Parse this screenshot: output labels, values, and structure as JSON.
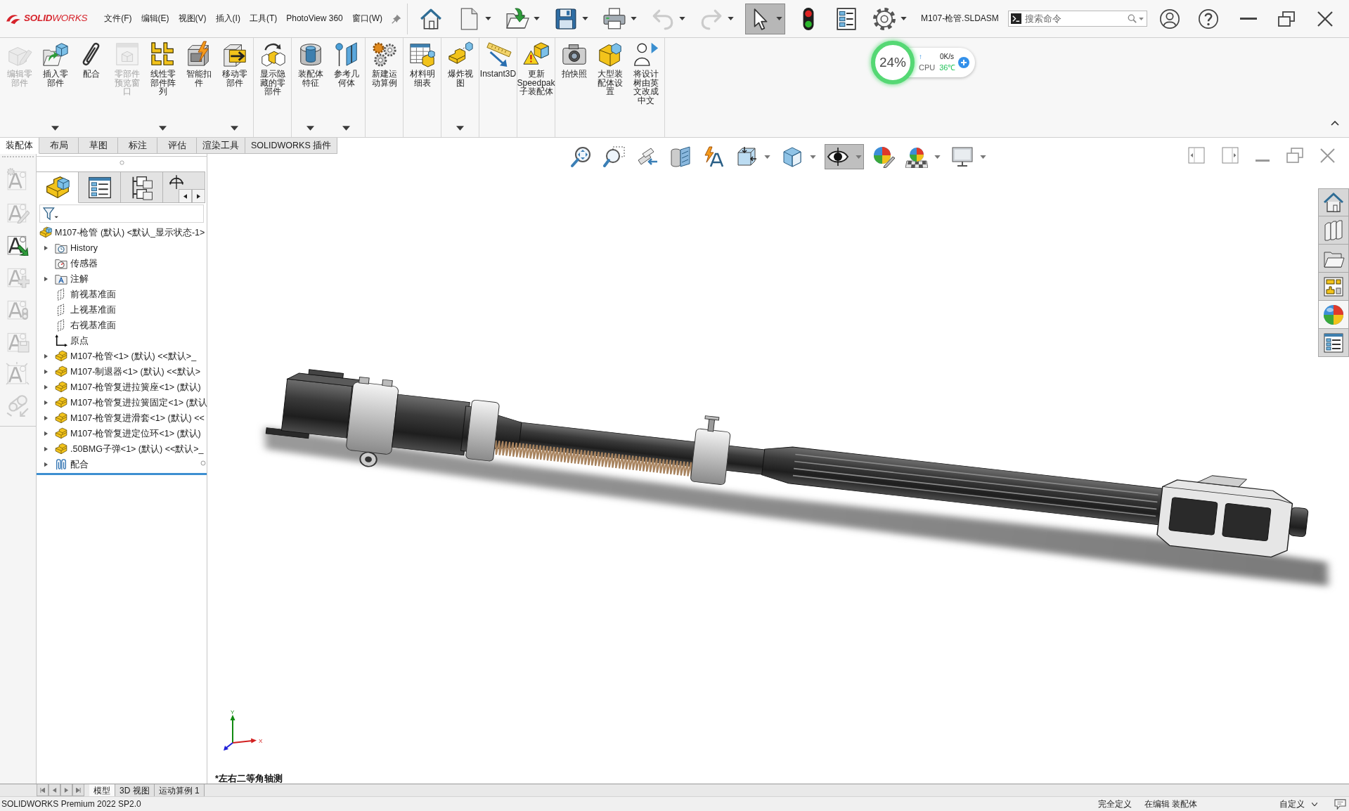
{
  "title_bar": {
    "logo": "**SOLID**WORKS",
    "menus": [
      "文件(F)",
      "编辑(E)",
      "视图(V)",
      "插入(I)",
      "工具(T)",
      "PhotoView 360",
      "窗口(W)"
    ],
    "tools": [
      {
        "kind": "home",
        "dropdown": false,
        "disabled": false,
        "pressed": false
      },
      {
        "kind": "new",
        "dropdown": true,
        "disabled": false,
        "pressed": false
      },
      {
        "kind": "open",
        "dropdown": true,
        "disabled": false,
        "pressed": false
      },
      {
        "kind": "save",
        "dropdown": true,
        "disabled": false,
        "pressed": false
      },
      {
        "kind": "print",
        "dropdown": true,
        "disabled": false,
        "pressed": false
      },
      {
        "kind": "undo",
        "dropdown": true,
        "disabled": true,
        "pressed": false
      },
      {
        "kind": "redo",
        "dropdown": true,
        "disabled": true,
        "pressed": false
      },
      {
        "kind": "select",
        "dropdown": true,
        "disabled": false,
        "pressed": true
      },
      {
        "kind": "rebuild",
        "dropdown": false,
        "disabled": false,
        "pressed": false
      },
      {
        "kind": "file-properties",
        "dropdown": false,
        "disabled": false,
        "pressed": false
      },
      {
        "kind": "options",
        "dropdown": true,
        "disabled": false,
        "pressed": false
      }
    ],
    "document_title": "M107-枪管.SLDASM",
    "search": {
      "placeholder": "搜索命令"
    }
  },
  "system_monitor": {
    "load": "24%",
    "arrow": "↑",
    "speed": "0K/s",
    "label": "CPU",
    "temperature": "36℃"
  },
  "command_manager": {
    "groups": [
      {
        "commands": [
          {
            "label": "编辑零部件",
            "kind": "edit-part",
            "dropdown": false,
            "disabled": true
          },
          {
            "label": "插入零部件",
            "kind": "insert-part",
            "dropdown": true,
            "disabled": false
          },
          {
            "label": "配合",
            "kind": "mate",
            "dropdown": false,
            "disabled": false
          },
          {
            "label": "零部件预览窗口",
            "kind": "preview-window",
            "dropdown": false,
            "disabled": true
          },
          {
            "label": "线性零部件阵列",
            "kind": "linear-pattern",
            "dropdown": true,
            "disabled": false
          },
          {
            "label": "智能扣件",
            "kind": "smart-fastener",
            "dropdown": false,
            "disabled": false
          },
          {
            "label": "移动零部件",
            "kind": "move-part",
            "dropdown": true,
            "disabled": false
          }
        ]
      },
      {
        "commands": [
          {
            "label": "显示隐藏的零部件",
            "kind": "show-hidden",
            "dropdown": false,
            "disabled": false
          }
        ]
      },
      {
        "commands": [
          {
            "label": "装配体特征",
            "kind": "assembly-feature",
            "dropdown": true,
            "disabled": false
          },
          {
            "label": "参考几何体",
            "kind": "reference-geometry",
            "dropdown": true,
            "disabled": false
          }
        ]
      },
      {
        "commands": [
          {
            "label": "新建运动算例",
            "kind": "motion-study",
            "dropdown": false,
            "disabled": false
          }
        ]
      },
      {
        "commands": [
          {
            "label": "材料明细表",
            "kind": "bom",
            "dropdown": false,
            "disabled": false
          }
        ]
      },
      {
        "commands": [
          {
            "label": "爆炸视图",
            "kind": "exploded-view",
            "dropdown": true,
            "disabled": false
          }
        ]
      },
      {
        "commands": [
          {
            "label": "Instant3D",
            "kind": "instant3d",
            "dropdown": false,
            "disabled": false
          }
        ]
      },
      {
        "commands": [
          {
            "label": "更新Speedpak子装配体",
            "kind": "speedpak",
            "dropdown": false,
            "disabled": false
          }
        ]
      },
      {
        "commands": [
          {
            "label": "拍快照",
            "kind": "snapshot",
            "dropdown": false,
            "disabled": false
          },
          {
            "label": "大型装配体设置",
            "kind": "large-assembly",
            "dropdown": false,
            "disabled": false
          },
          {
            "label": "将设计树由英文改成中文",
            "kind": "translate-tree",
            "dropdown": false,
            "disabled": false
          }
        ]
      }
    ]
  },
  "tabs": [
    {
      "label": "装配体",
      "selected": true
    },
    {
      "label": "布局",
      "selected": false
    },
    {
      "label": "草图",
      "selected": false
    },
    {
      "label": "标注",
      "selected": false
    },
    {
      "label": "评估",
      "selected": false
    },
    {
      "label": "渲染工具",
      "selected": false
    },
    {
      "label": "SOLIDWORKS 插件",
      "selected": false
    }
  ],
  "left_toolbar": [
    {
      "kind": "annotation-settings",
      "disabled": true
    },
    {
      "kind": "annotation-edit",
      "disabled": true
    },
    {
      "kind": "annotation-import",
      "disabled": false
    },
    {
      "kind": "annotation-add",
      "disabled": true
    },
    {
      "kind": "annotation-status",
      "disabled": true
    },
    {
      "kind": "annotation-save",
      "disabled": true
    },
    {
      "kind": "annotation-burst",
      "disabled": true
    },
    {
      "kind": "linkage",
      "disabled": true
    }
  ],
  "feature_manager": {
    "tabs": [
      {
        "kind": "feature-tree",
        "selected": true
      },
      {
        "kind": "property-manager",
        "selected": false
      },
      {
        "kind": "configuration-manager",
        "selected": false
      },
      {
        "kind": "dimxpert-manager",
        "selected": false
      }
    ],
    "tree": [
      {
        "label": "M107-枪管 (默认) <默认_显示状态-1>",
        "kind": "assembly",
        "expander": false,
        "children": [
          {
            "label": "History",
            "kind": "history",
            "expander": true
          },
          {
            "label": "传感器",
            "kind": "sensors",
            "expander": false
          },
          {
            "label": "注解",
            "kind": "annotations",
            "expander": true
          },
          {
            "label": "前视基准面",
            "kind": "plane",
            "expander": false
          },
          {
            "label": "上视基准面",
            "kind": "plane",
            "expander": false
          },
          {
            "label": "右视基准面",
            "kind": "plane",
            "expander": false
          },
          {
            "label": "原点",
            "kind": "origin",
            "expander": false
          },
          {
            "label": "M107-枪管<1> (默认) <<默认>_",
            "kind": "part",
            "expander": true
          },
          {
            "label": "M107-制退器<1> (默认) <<默认>",
            "kind": "part",
            "expander": true
          },
          {
            "label": "M107-枪管复进拉簧座<1> (默认)",
            "kind": "part",
            "expander": true
          },
          {
            "label": "M107-枪管复进拉簧固定<1> (默认",
            "kind": "part",
            "expander": true
          },
          {
            "label": "M107-枪管复进滑套<1> (默认) <<",
            "kind": "part",
            "expander": true
          },
          {
            "label": "M107-枪管复进定位环<1> (默认)",
            "kind": "part",
            "expander": true
          },
          {
            "label": ".50BMG子弹<1> (默认) <<默认>_",
            "kind": "part",
            "expander": true
          },
          {
            "label": "配合",
            "kind": "mates",
            "expander": true
          }
        ]
      }
    ]
  },
  "view_toolbar": [
    {
      "kind": "zoom-to-fit",
      "dropdown": false,
      "pressed": false
    },
    {
      "kind": "zoom-area",
      "dropdown": false,
      "pressed": false
    },
    {
      "kind": "previous-view",
      "dropdown": false,
      "pressed": false
    },
    {
      "kind": "section-view",
      "dropdown": false,
      "pressed": false
    },
    {
      "kind": "dynamic-annotation",
      "dropdown": false,
      "pressed": false
    },
    {
      "kind": "view-orientation",
      "dropdown": true,
      "pressed": false
    },
    {
      "kind": "display-style",
      "dropdown": true,
      "pressed": false
    },
    {
      "kind": "hide-show",
      "dropdown": true,
      "pressed": true
    },
    {
      "kind": "edit-appearance",
      "dropdown": false,
      "pressed": false
    },
    {
      "kind": "apply-scene",
      "dropdown": true,
      "pressed": false
    },
    {
      "kind": "view-settings",
      "dropdown": true,
      "pressed": false
    }
  ],
  "task_pane": [
    {
      "kind": "home",
      "selected": false
    },
    {
      "kind": "design-library",
      "selected": false
    },
    {
      "kind": "file-explorer",
      "selected": false
    },
    {
      "kind": "view-palette",
      "selected": false
    },
    {
      "kind": "appearances",
      "selected": true
    },
    {
      "kind": "custom-properties",
      "selected": false
    }
  ],
  "viewport": {
    "view_name": "*左右二等角轴测",
    "triad": {
      "y_label": "Y",
      "x_label": "X"
    }
  },
  "bottom_tabs": [
    {
      "label": "模型",
      "selected": true
    },
    {
      "label": "3D 视图",
      "selected": false
    },
    {
      "label": "运动算例 1",
      "selected": false
    }
  ],
  "status_bar": {
    "product": "SOLIDWORKS Premium 2022 SP2.0",
    "state": "完全定义",
    "mode": "在编辑 装配体",
    "units": "自定义"
  }
}
